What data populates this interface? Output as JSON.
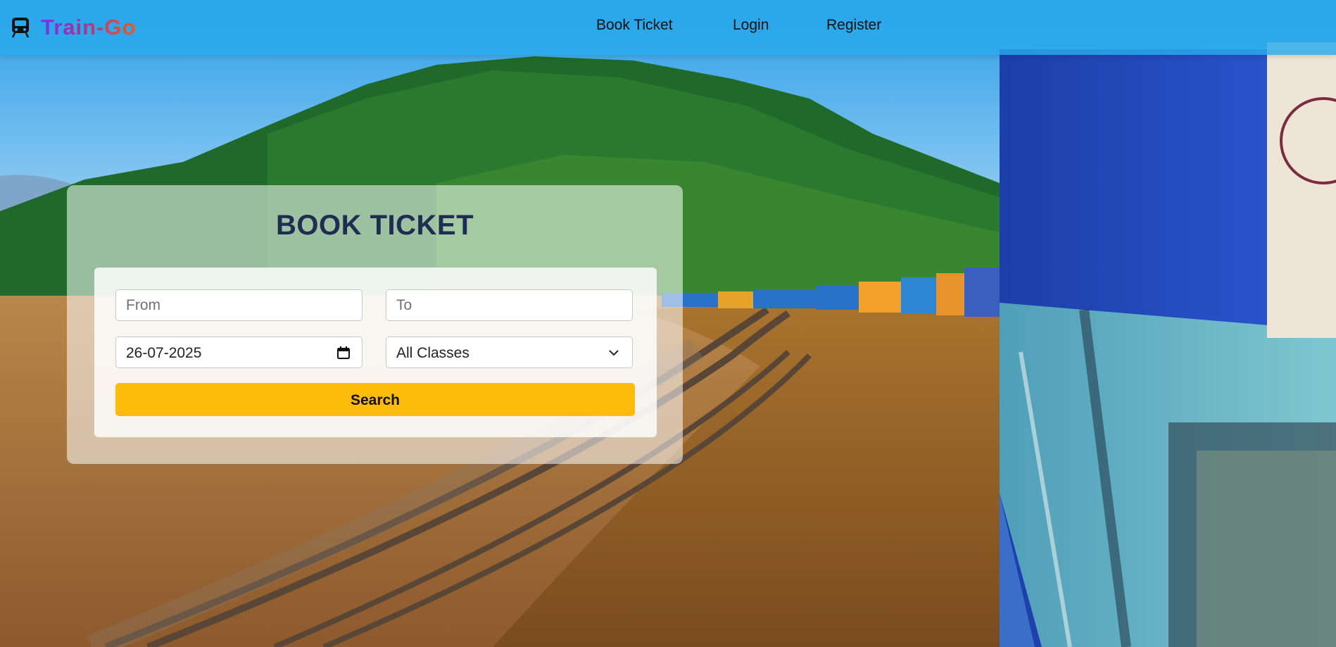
{
  "brand": {
    "name": "Train-Go",
    "icon": "train-icon"
  },
  "nav": {
    "book_ticket": "Book Ticket",
    "login": "Login",
    "register": "Register"
  },
  "booking": {
    "title": "BOOK TICKET",
    "from": {
      "placeholder": "From",
      "value": ""
    },
    "to": {
      "placeholder": "To",
      "value": ""
    },
    "date": {
      "value": "26-07-2025",
      "icon": "calendar-icon"
    },
    "class_select": {
      "value": "All Classes",
      "icon": "chevron-down-icon"
    },
    "search_label": "Search"
  },
  "colors": {
    "navbar": "#28aaeb",
    "accent_button": "#fdbb0b",
    "title_text": "#1f2d52",
    "brand_gradient": [
      "#7b2ff0",
      "#f05a1d"
    ]
  }
}
